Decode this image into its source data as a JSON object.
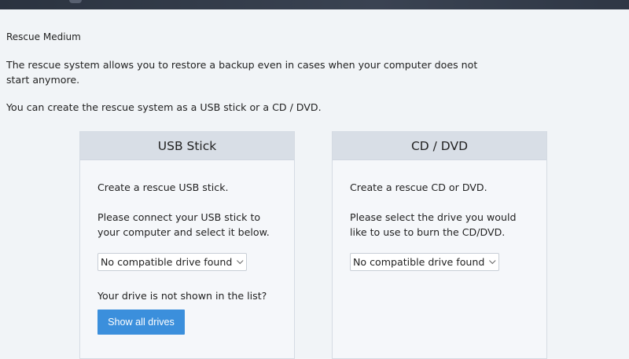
{
  "section": {
    "title": "Rescue Medium",
    "intro": "The rescue system allows you to restore a backup even in cases when your computer does not start anymore.",
    "intro2": "You can create the rescue system as a USB stick or a CD / DVD."
  },
  "usb": {
    "title": "USB Stick",
    "line1": "Create a rescue USB stick.",
    "line2": "Please connect your USB stick to your computer and select it below.",
    "select_value": "No compatible drive found",
    "question": "Your drive is not shown in the list?",
    "button_label": "Show all drives"
  },
  "cd": {
    "title": "CD / DVD",
    "line1": "Create a rescue CD or DVD.",
    "line2": "Please select the drive you would like to use to burn the CD/DVD.",
    "select_value": "No compatible drive found"
  },
  "colors": {
    "accent": "#3b8fdc",
    "card_header": "#d8dee6",
    "background": "#f1f4f7"
  },
  "icons": {
    "dropdown": "chevron-down-icon"
  }
}
